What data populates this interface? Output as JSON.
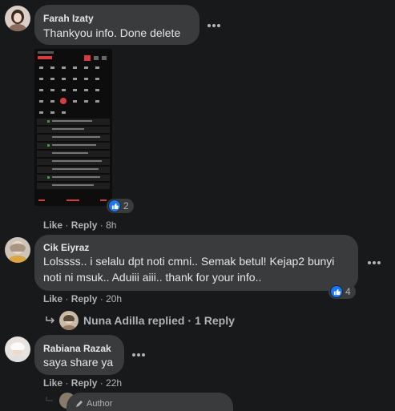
{
  "comments": [
    {
      "author": "Farah Izaty",
      "text": "Thankyou info. Done delete",
      "like": "Like",
      "reply": "Reply",
      "time": "8h",
      "reaction_count": "2"
    },
    {
      "author": "Cik Eiyraz",
      "text_line1": "Lolssss.. i selalu dpt noti cmni.. Semak betul! Kejap2 bunyi",
      "text_line2": "noti ni msuk.. Aduiii aiii.. thank for your info..",
      "like": "Like",
      "reply": "Reply",
      "time": "20h",
      "reaction_count": "4"
    },
    {
      "author": "Rabiana Razak",
      "text": "saya share ya",
      "like": "Like",
      "reply": "Reply",
      "time": "22h"
    }
  ],
  "replies_summary": {
    "name": "Nuna Adilla",
    "text": "replied",
    "sep": "·",
    "count": "1 Reply"
  },
  "author_badge": "Author",
  "separator": "·",
  "colors": {
    "background": "#18191a",
    "bubble": "#3a3b3c",
    "like_blue": "#1877f2",
    "secondary_text": "#b0b3b8"
  }
}
